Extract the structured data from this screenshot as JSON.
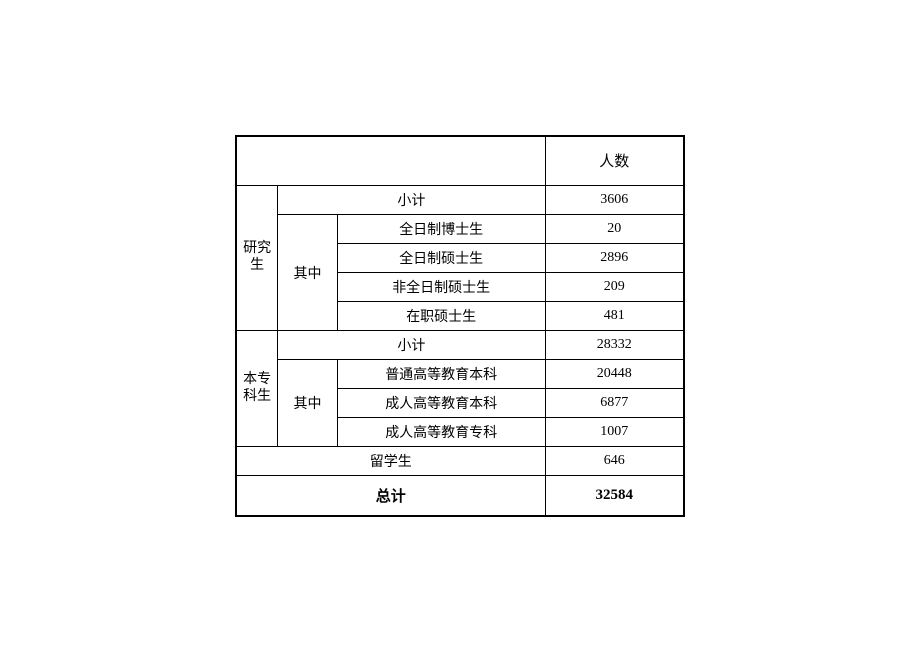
{
  "header": {
    "blank": "",
    "count": "人数"
  },
  "groups": [
    {
      "name": "研究生",
      "subtotal_label": "小计",
      "subtotal_value": "3606",
      "including_label": "其中",
      "items": [
        {
          "label": "全日制博士生",
          "value": "20"
        },
        {
          "label": "全日制硕士生",
          "value": "2896"
        },
        {
          "label": "非全日制硕士生",
          "value": "209"
        },
        {
          "label": "在职硕士生",
          "value": "481"
        }
      ]
    },
    {
      "name": "本专科生",
      "subtotal_label": "小计",
      "subtotal_value": "28332",
      "including_label": "其中",
      "items": [
        {
          "label": "普通高等教育本科",
          "value": "20448"
        },
        {
          "label": "成人高等教育本科",
          "value": "6877"
        },
        {
          "label": "成人高等教育专科",
          "value": "1007"
        }
      ]
    }
  ],
  "intl": {
    "label": "留学生",
    "value": "646"
  },
  "total": {
    "label": "总计",
    "value": "32584"
  }
}
